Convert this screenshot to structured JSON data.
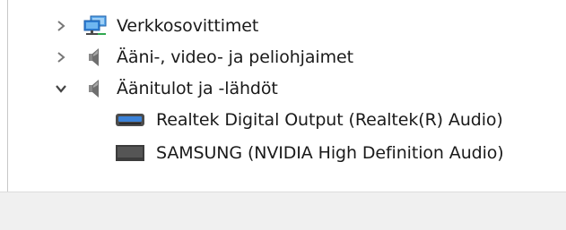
{
  "device_tree": {
    "categories": [
      {
        "label": "Verkkosovittimet",
        "icon": "network-adapter-icon",
        "expanded": false
      },
      {
        "label": "Ääni-, video- ja peliohjaimet",
        "icon": "speaker-icon",
        "expanded": false
      },
      {
        "label": "Äänitulot ja -lähdöt",
        "icon": "speaker-icon",
        "expanded": true
      }
    ],
    "children": [
      {
        "label": "Realtek Digital Output (Realtek(R) Audio)",
        "icon": "digital-output-icon"
      },
      {
        "label": "SAMSUNG (NVIDIA High Definition Audio)",
        "icon": "monitor-icon"
      }
    ]
  },
  "colors": {
    "chevron": "#777777",
    "network_blue": "#2f7fd6",
    "speaker_gray": "#6f6f6f",
    "device_dark": "#3c3c3c",
    "status_bar": "#f0f0f0"
  }
}
